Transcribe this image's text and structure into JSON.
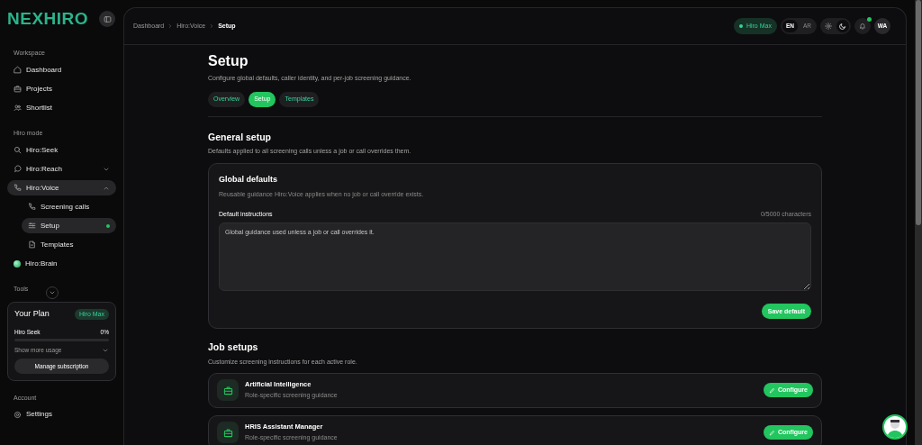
{
  "brand": {
    "logo": "NEXHIRO"
  },
  "sidebar": {
    "sections": [
      {
        "title": "Workspace",
        "items": [
          {
            "label": "Dashboard",
            "selected": false
          },
          {
            "label": "Projects",
            "selected": false
          },
          {
            "label": "Shortlist",
            "selected": false
          }
        ]
      },
      {
        "title": "Hiro mode",
        "items": [
          {
            "label": "Hiro:Seek",
            "selected": false
          },
          {
            "label": "Hiro:Reach",
            "selected": false,
            "expanded": false
          },
          {
            "label": "Hiro:Voice",
            "selected": true,
            "expanded": true,
            "children": [
              {
                "label": "Screening calls",
                "selected": false
              },
              {
                "label": "Setup",
                "selected": true
              },
              {
                "label": "Templates",
                "selected": false
              }
            ]
          },
          {
            "label": "Hiro:Brain",
            "selected": false
          }
        ]
      },
      {
        "title": "Tools"
      }
    ],
    "plan": {
      "title": "Your Plan",
      "badge": "Hiro Max",
      "usage_label": "Hiro Seek",
      "usage_value": "0%",
      "level": 0,
      "more": "Show more usage",
      "button": "Manage subscription"
    },
    "account": {
      "title": "Account",
      "items": [
        {
          "label": "Settings",
          "selected": false
        }
      ]
    }
  },
  "topbar": {
    "breadcrumbs": [
      "Dashboard",
      "Hiro:Voice",
      "Setup"
    ],
    "plan_chip": "Hiro Max",
    "languages": [
      {
        "label": "EN",
        "selected": true
      },
      {
        "label": "AR",
        "selected": false
      }
    ],
    "themes": [
      {
        "kind": "light",
        "selected": false
      },
      {
        "kind": "dark",
        "selected": true
      }
    ],
    "notifications_unread": true,
    "avatar": "WA"
  },
  "page": {
    "title": "Setup",
    "subtitle": "Configure global defaults, caller identity, and per-job screening guidance.",
    "tabs": [
      {
        "label": "Overview",
        "selected": false
      },
      {
        "label": "Setup",
        "selected": true
      },
      {
        "label": "Templates",
        "selected": false
      }
    ],
    "general": {
      "title": "General setup",
      "description": "Defaults applied to all screening calls unless a job or call overrides them.",
      "card": {
        "title": "Global defaults",
        "description": "Reusable guidance Hiro:Voice applies when no job or call override exists.",
        "field_label": "Default instructions",
        "counter": "0/5000 characters",
        "placeholder": "Global guidance used unless a job or call overrides it.",
        "button": "Save default"
      }
    },
    "jobs": {
      "title": "Job setups",
      "description": "Customize screening instructions for each active role.",
      "items": [
        {
          "title": "Artificial Intelligence",
          "subtitle": "Role-specific screening guidance",
          "button": "Configure"
        },
        {
          "title": "HRIS Assistant Manager",
          "subtitle": "Role-specific screening guidance",
          "button": "Configure"
        }
      ]
    }
  }
}
